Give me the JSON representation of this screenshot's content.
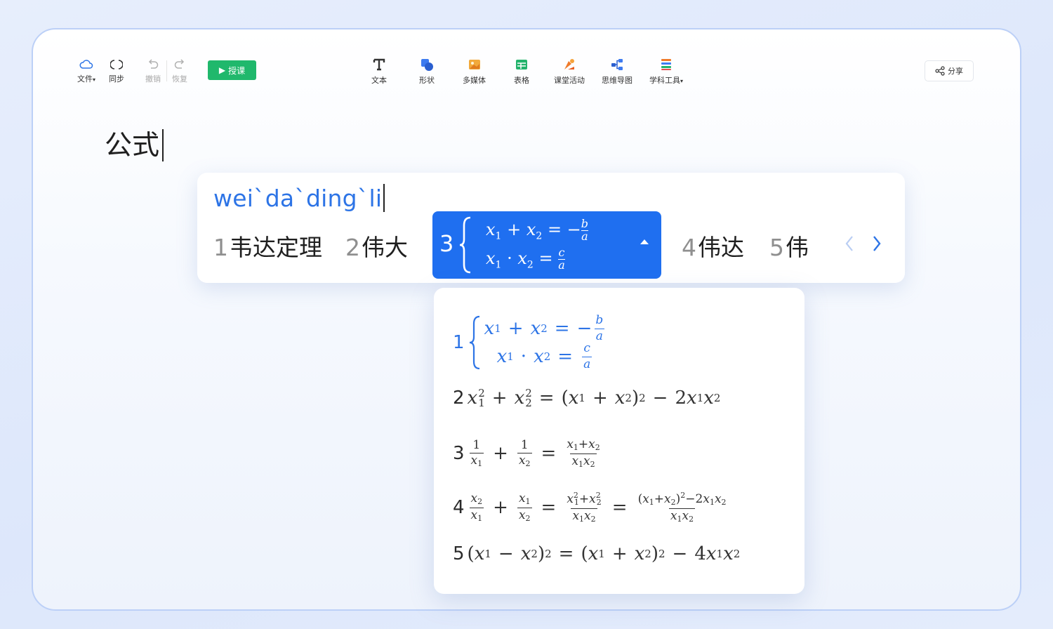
{
  "toolbar": {
    "file_label": "文件",
    "sync_label": "同步",
    "undo_label": "撤销",
    "redo_label": "恢复",
    "teach_label": "授课",
    "share_label": "分享",
    "insert_tools": [
      {
        "label": "文本",
        "icon": "text-icon"
      },
      {
        "label": "形状",
        "icon": "shape-icon"
      },
      {
        "label": "多媒体",
        "icon": "media-icon"
      },
      {
        "label": "表格",
        "icon": "table-icon"
      },
      {
        "label": "课堂活动",
        "icon": "class-activity-icon"
      },
      {
        "label": "思维导图",
        "icon": "mind-map-icon"
      },
      {
        "label": "学科工具",
        "icon": "subject-tools-icon"
      }
    ]
  },
  "document": {
    "text": "公式"
  },
  "ime": {
    "pinyin": "wei`da`ding`li",
    "candidates": [
      {
        "index": "1",
        "text": "韦达定理"
      },
      {
        "index": "2",
        "text": "伟大"
      },
      {
        "index": "3",
        "text": "x₁ + x₂ = −b/a ; x₁ · x₂ = c/a",
        "selected": true
      },
      {
        "index": "4",
        "text": "伟达"
      },
      {
        "index": "5",
        "text": "伟"
      }
    ]
  },
  "formula_list": {
    "items": [
      {
        "index": "1"
      },
      {
        "index": "2"
      },
      {
        "index": "3"
      },
      {
        "index": "4"
      },
      {
        "index": "5"
      }
    ]
  },
  "colors": {
    "accent_blue": "#1f6ff0",
    "teach_green": "#20b86c",
    "pinyin_blue": "#2d74e6"
  }
}
